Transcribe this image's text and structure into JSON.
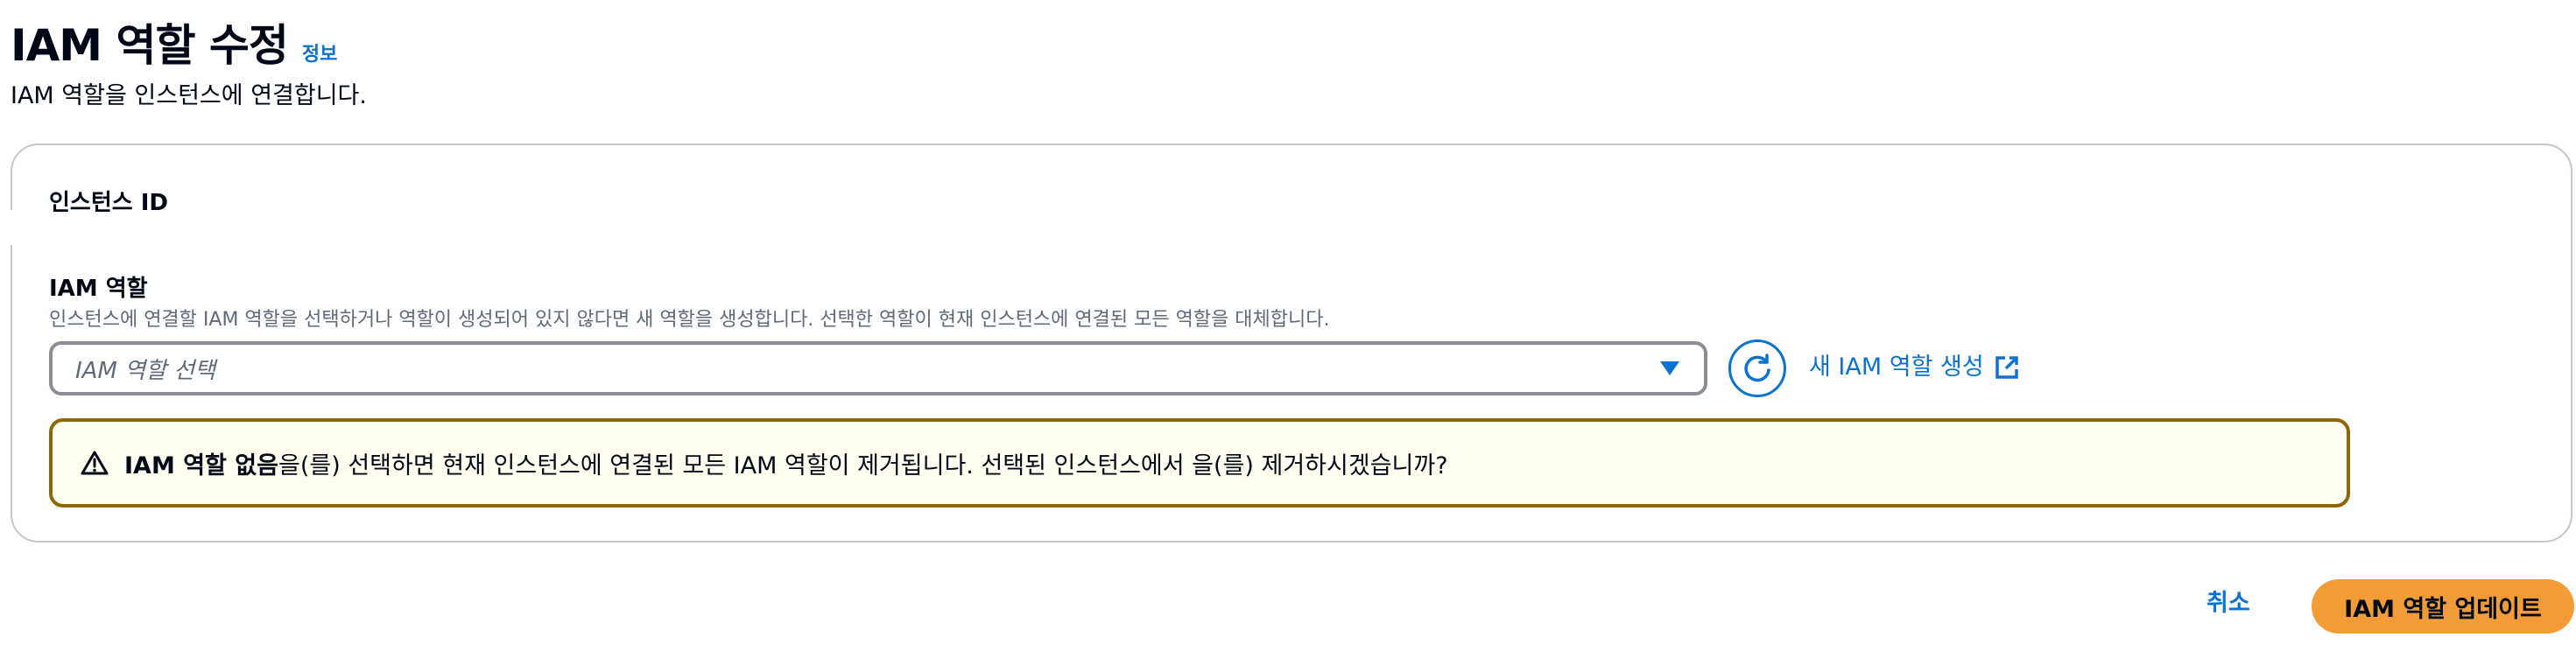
{
  "header": {
    "title": "IAM 역할 수정",
    "info_link": "정보",
    "description": "IAM 역할을 인스턴스에 연결합니다."
  },
  "form": {
    "instance_id_label": "인스턴스 ID",
    "iam_role_label": "IAM 역할",
    "iam_role_description": "인스턴스에 연결할 IAM 역할을 선택하거나 역할이 생성되어 있지 않다면 새 역할을 생성합니다. 선택한 역할이 현재 인스턴스에 연결된 모든 역할을 대체합니다.",
    "role_select": {
      "placeholder": "IAM 역할 선택",
      "dropdown_icon": "caret-down-icon"
    },
    "refresh_icon": "refresh-icon",
    "create_role_link": "새 IAM 역할 생성",
    "create_role_icon": "external-link-icon"
  },
  "alert": {
    "icon": "warning-icon",
    "strong_text": "IAM 역할 없음",
    "message": "을(를) 선택하면 현재 인스턴스에 연결된 모든 IAM 역할이 제거됩니다. 선택된 인스턴스에서 을(를) 제거하시겠습니까?"
  },
  "actions": {
    "cancel_label": "취소",
    "update_label": "IAM 역할 업데이트"
  },
  "colors": {
    "link": "#0972d3",
    "primary_button": "#f29c38",
    "warning_border": "#8d6605",
    "warning_background": "#fffef0",
    "text": "#000716",
    "muted_text": "#5f6b7a"
  }
}
